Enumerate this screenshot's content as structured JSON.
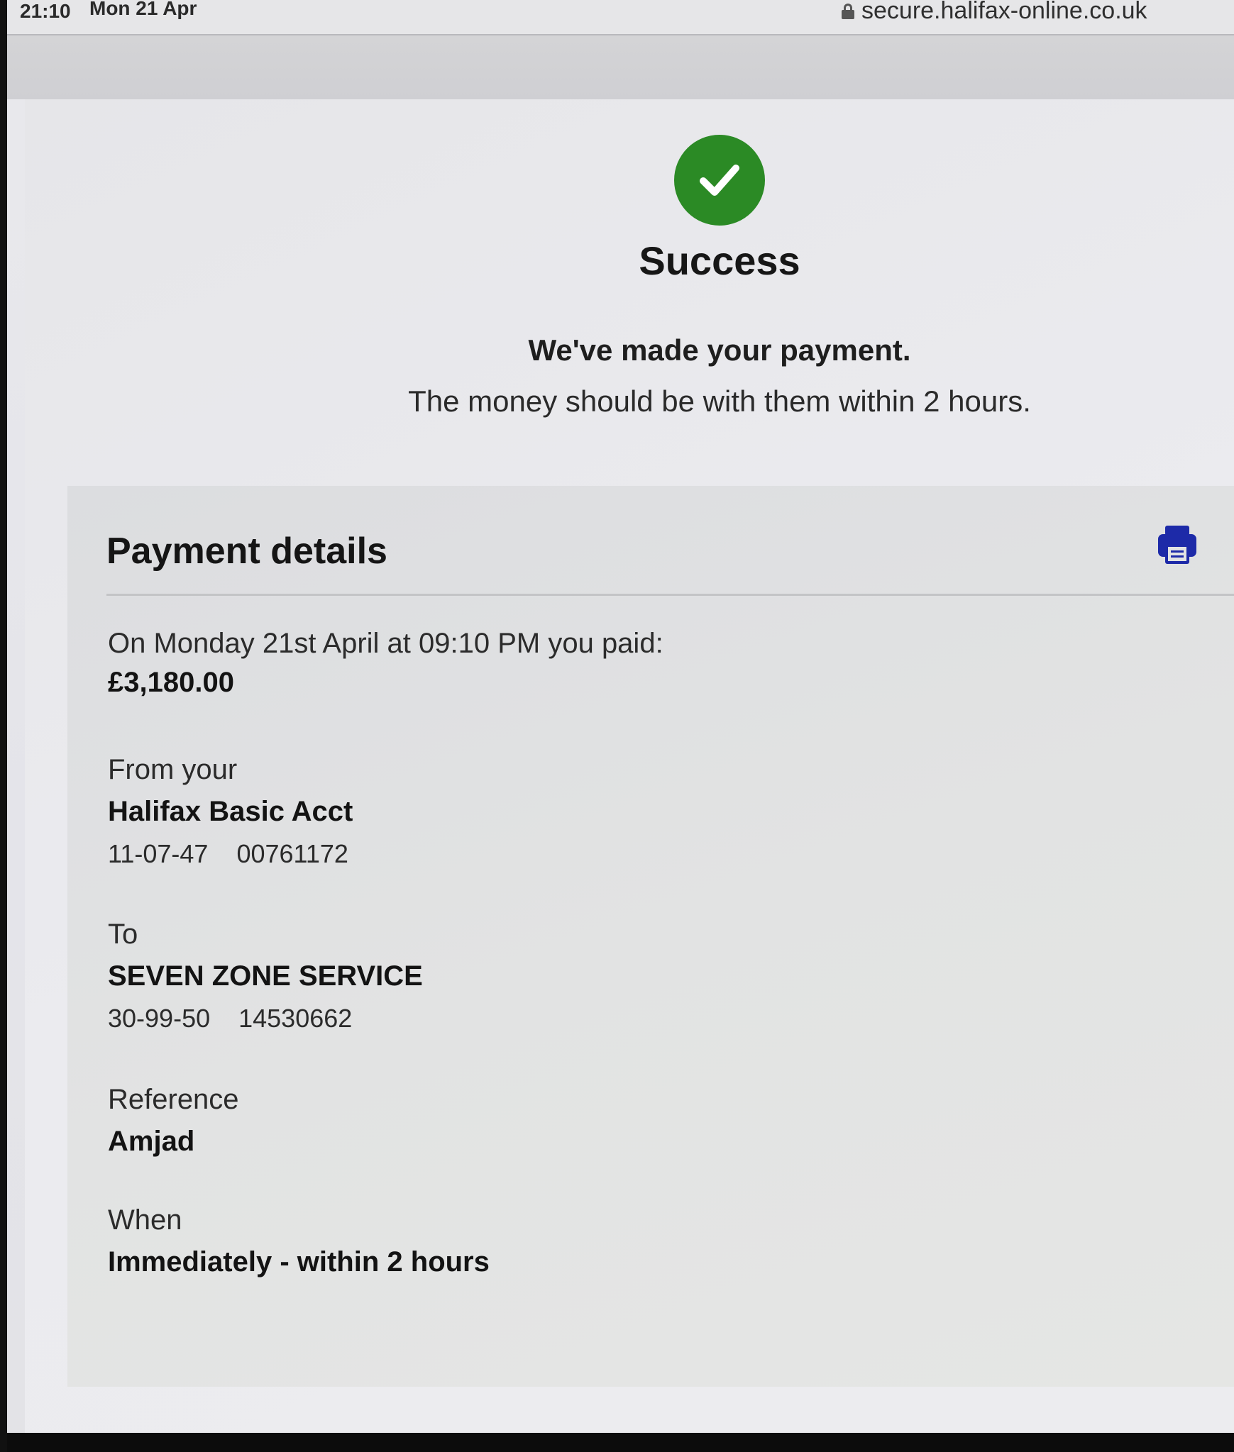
{
  "status_bar": {
    "time": "21:10",
    "date": "Mon 21 Apr",
    "url": "secure.halifax-online.co.uk"
  },
  "success": {
    "icon": "check-circle-icon",
    "icon_color": "#2b8a25",
    "title": "Success",
    "heading": "We've made your payment.",
    "subtext": "The money should be with them within 2 hours."
  },
  "payment_details": {
    "title": "Payment details",
    "print_icon": "printer-icon",
    "print_icon_color": "#1d2aa8",
    "paid_label": "On Monday 21st April at 09:10 PM you paid:",
    "amount": "£3,180.00",
    "from": {
      "label": "From your",
      "account_name": "Halifax Basic Acct",
      "sort_code": "11-07-47",
      "account_number": "00761172"
    },
    "to": {
      "label": "To",
      "payee_name": "SEVEN ZONE SERVICE",
      "sort_code": "30-99-50",
      "account_number": "14530662"
    },
    "reference": {
      "label": "Reference",
      "value": "Amjad"
    },
    "when": {
      "label": "When",
      "value": "Immediately - within 2 hours"
    }
  }
}
